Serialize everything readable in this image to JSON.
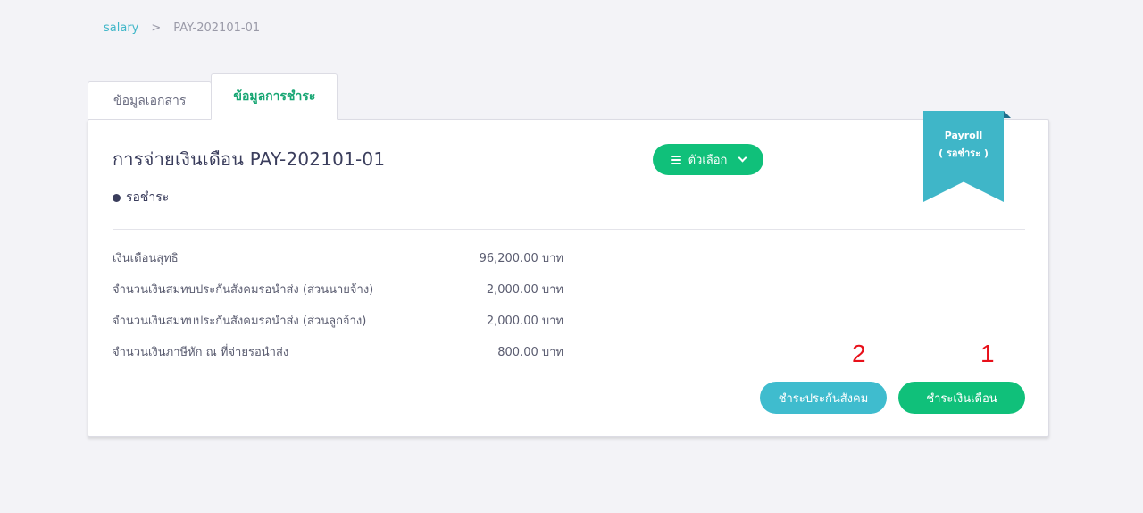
{
  "breadcrumb": {
    "root": "salary",
    "separator": ">",
    "current": "PAY-202101-01"
  },
  "tabs": [
    {
      "label": "ข้อมูลเอกสาร",
      "active": false
    },
    {
      "label": "ข้อมูลการชำระ",
      "active": true
    }
  ],
  "card": {
    "title": "การจ่ายเงินเดือน PAY-202101-01",
    "options_label": "ตัวเลือก",
    "status": "รอชำระ",
    "ribbon": {
      "line1": "Payroll",
      "line2": "( รอชำระ )"
    },
    "rows": [
      {
        "label": "เงินเดือนสุทธิ",
        "value": "96,200.00 บาท"
      },
      {
        "label": "จำนวนเงินสมทบประกันสังคมรอนำส่ง (ส่วนนายจ้าง)",
        "value": "2,000.00 บาท"
      },
      {
        "label": "จำนวนเงินสมทบประกันสังคมรอนำส่ง (ส่วนลูกจ้าง)",
        "value": "2,000.00 บาท"
      },
      {
        "label": "จำนวนเงินภาษีหัก ณ ที่จ่ายรอนำส่ง",
        "value": "800.00 บาท"
      }
    ],
    "buttons": {
      "sso": "ชำระประกันสังคม",
      "salary": "ชำระเงินเดือน"
    },
    "markers": {
      "sso": "2",
      "salary": "1"
    }
  },
  "colors": {
    "primary": "#10c07a",
    "secondary": "#3fbcce",
    "marker": "#e8101a"
  }
}
